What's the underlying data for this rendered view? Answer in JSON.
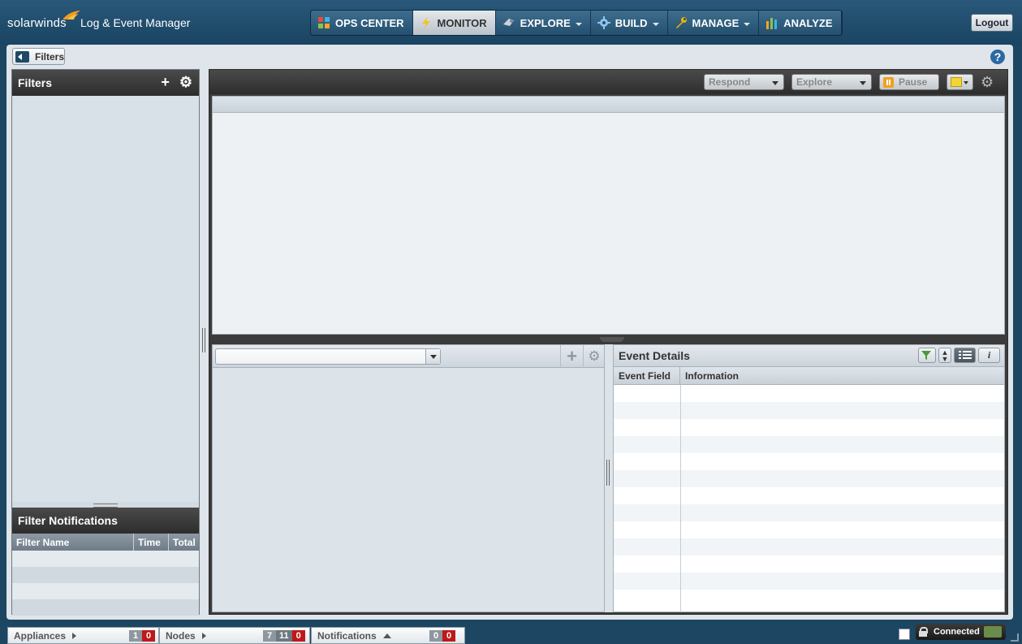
{
  "app": {
    "brand": "solarwinds",
    "product": "Log & Event Manager",
    "logout_label": "Logout"
  },
  "nav": {
    "tabs": [
      {
        "label": "OPS CENTER",
        "icon": "ops-center-icon",
        "dropdown": false,
        "active": false
      },
      {
        "label": "MONITOR",
        "icon": "lightning-icon",
        "dropdown": false,
        "active": true
      },
      {
        "label": "EXPLORE",
        "icon": "explore-icon",
        "dropdown": true,
        "active": false
      },
      {
        "label": "BUILD",
        "icon": "gear-icon",
        "dropdown": true,
        "active": false
      },
      {
        "label": "MANAGE",
        "icon": "wrench-icon",
        "dropdown": true,
        "active": false
      },
      {
        "label": "ANALYZE",
        "icon": "bar-chart-icon",
        "dropdown": false,
        "active": false
      }
    ]
  },
  "filters_toggle": {
    "label": "Filters"
  },
  "help": {
    "label": "?"
  },
  "left_panel": {
    "filters_title": "Filters",
    "notifications_title": "Filter Notifications",
    "notification_columns": [
      "Filter Name",
      "Time",
      "Total"
    ]
  },
  "toolbar": {
    "respond_label": "Respond",
    "explore_label": "Explore",
    "pause_label": "Pause"
  },
  "event_details": {
    "title": "Event Details",
    "columns": [
      "Event Field",
      "Information"
    ],
    "info_button": "i"
  },
  "status_bar": {
    "appliances": {
      "label": "Appliances",
      "counts": [
        "1",
        "0"
      ]
    },
    "nodes": {
      "label": "Nodes",
      "counts": [
        "7",
        "11",
        "0"
      ]
    },
    "notifications": {
      "label": "Notifications",
      "counts": [
        "0",
        "0"
      ]
    },
    "connection": "Connected"
  },
  "colors": {
    "topbar": "#1c4661",
    "panel_header": "#2d2d2d",
    "alert_red": "#c01818",
    "active_tab": "#d0d6dc"
  }
}
